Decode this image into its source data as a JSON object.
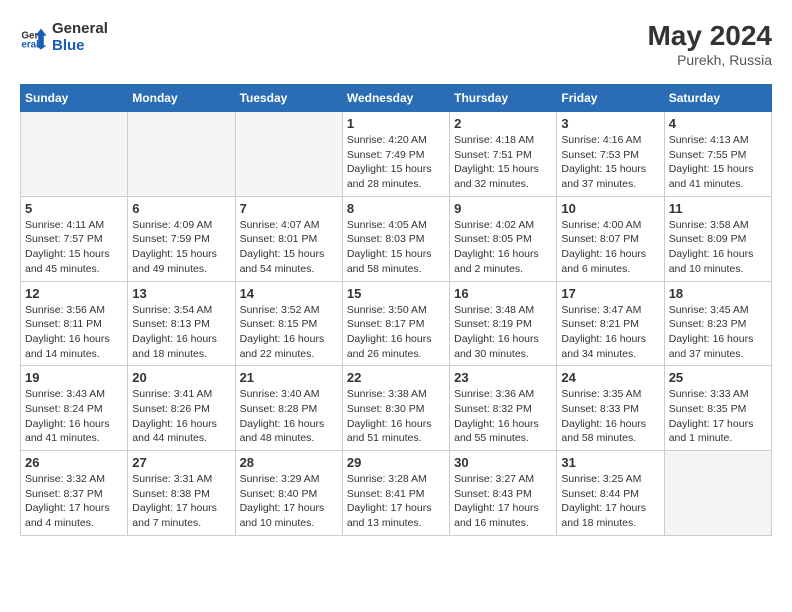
{
  "header": {
    "logo_line1": "General",
    "logo_line2": "Blue",
    "month_year": "May 2024",
    "location": "Purekh, Russia"
  },
  "weekdays": [
    "Sunday",
    "Monday",
    "Tuesday",
    "Wednesday",
    "Thursday",
    "Friday",
    "Saturday"
  ],
  "weeks": [
    [
      {
        "day": "",
        "empty": true
      },
      {
        "day": "",
        "empty": true
      },
      {
        "day": "",
        "empty": true
      },
      {
        "day": "1",
        "sunrise": "4:20 AM",
        "sunset": "7:49 PM",
        "daylight": "15 hours and 28 minutes."
      },
      {
        "day": "2",
        "sunrise": "4:18 AM",
        "sunset": "7:51 PM",
        "daylight": "15 hours and 32 minutes."
      },
      {
        "day": "3",
        "sunrise": "4:16 AM",
        "sunset": "7:53 PM",
        "daylight": "15 hours and 37 minutes."
      },
      {
        "day": "4",
        "sunrise": "4:13 AM",
        "sunset": "7:55 PM",
        "daylight": "15 hours and 41 minutes."
      }
    ],
    [
      {
        "day": "5",
        "sunrise": "4:11 AM",
        "sunset": "7:57 PM",
        "daylight": "15 hours and 45 minutes."
      },
      {
        "day": "6",
        "sunrise": "4:09 AM",
        "sunset": "7:59 PM",
        "daylight": "15 hours and 49 minutes."
      },
      {
        "day": "7",
        "sunrise": "4:07 AM",
        "sunset": "8:01 PM",
        "daylight": "15 hours and 54 minutes."
      },
      {
        "day": "8",
        "sunrise": "4:05 AM",
        "sunset": "8:03 PM",
        "daylight": "15 hours and 58 minutes."
      },
      {
        "day": "9",
        "sunrise": "4:02 AM",
        "sunset": "8:05 PM",
        "daylight": "16 hours and 2 minutes."
      },
      {
        "day": "10",
        "sunrise": "4:00 AM",
        "sunset": "8:07 PM",
        "daylight": "16 hours and 6 minutes."
      },
      {
        "day": "11",
        "sunrise": "3:58 AM",
        "sunset": "8:09 PM",
        "daylight": "16 hours and 10 minutes."
      }
    ],
    [
      {
        "day": "12",
        "sunrise": "3:56 AM",
        "sunset": "8:11 PM",
        "daylight": "16 hours and 14 minutes."
      },
      {
        "day": "13",
        "sunrise": "3:54 AM",
        "sunset": "8:13 PM",
        "daylight": "16 hours and 18 minutes."
      },
      {
        "day": "14",
        "sunrise": "3:52 AM",
        "sunset": "8:15 PM",
        "daylight": "16 hours and 22 minutes."
      },
      {
        "day": "15",
        "sunrise": "3:50 AM",
        "sunset": "8:17 PM",
        "daylight": "16 hours and 26 minutes."
      },
      {
        "day": "16",
        "sunrise": "3:48 AM",
        "sunset": "8:19 PM",
        "daylight": "16 hours and 30 minutes."
      },
      {
        "day": "17",
        "sunrise": "3:47 AM",
        "sunset": "8:21 PM",
        "daylight": "16 hours and 34 minutes."
      },
      {
        "day": "18",
        "sunrise": "3:45 AM",
        "sunset": "8:23 PM",
        "daylight": "16 hours and 37 minutes."
      }
    ],
    [
      {
        "day": "19",
        "sunrise": "3:43 AM",
        "sunset": "8:24 PM",
        "daylight": "16 hours and 41 minutes."
      },
      {
        "day": "20",
        "sunrise": "3:41 AM",
        "sunset": "8:26 PM",
        "daylight": "16 hours and 44 minutes."
      },
      {
        "day": "21",
        "sunrise": "3:40 AM",
        "sunset": "8:28 PM",
        "daylight": "16 hours and 48 minutes."
      },
      {
        "day": "22",
        "sunrise": "3:38 AM",
        "sunset": "8:30 PM",
        "daylight": "16 hours and 51 minutes."
      },
      {
        "day": "23",
        "sunrise": "3:36 AM",
        "sunset": "8:32 PM",
        "daylight": "16 hours and 55 minutes."
      },
      {
        "day": "24",
        "sunrise": "3:35 AM",
        "sunset": "8:33 PM",
        "daylight": "16 hours and 58 minutes."
      },
      {
        "day": "25",
        "sunrise": "3:33 AM",
        "sunset": "8:35 PM",
        "daylight": "17 hours and 1 minute."
      }
    ],
    [
      {
        "day": "26",
        "sunrise": "3:32 AM",
        "sunset": "8:37 PM",
        "daylight": "17 hours and 4 minutes."
      },
      {
        "day": "27",
        "sunrise": "3:31 AM",
        "sunset": "8:38 PM",
        "daylight": "17 hours and 7 minutes."
      },
      {
        "day": "28",
        "sunrise": "3:29 AM",
        "sunset": "8:40 PM",
        "daylight": "17 hours and 10 minutes."
      },
      {
        "day": "29",
        "sunrise": "3:28 AM",
        "sunset": "8:41 PM",
        "daylight": "17 hours and 13 minutes."
      },
      {
        "day": "30",
        "sunrise": "3:27 AM",
        "sunset": "8:43 PM",
        "daylight": "17 hours and 16 minutes."
      },
      {
        "day": "31",
        "sunrise": "3:25 AM",
        "sunset": "8:44 PM",
        "daylight": "17 hours and 18 minutes."
      },
      {
        "day": "",
        "empty": true
      }
    ]
  ]
}
